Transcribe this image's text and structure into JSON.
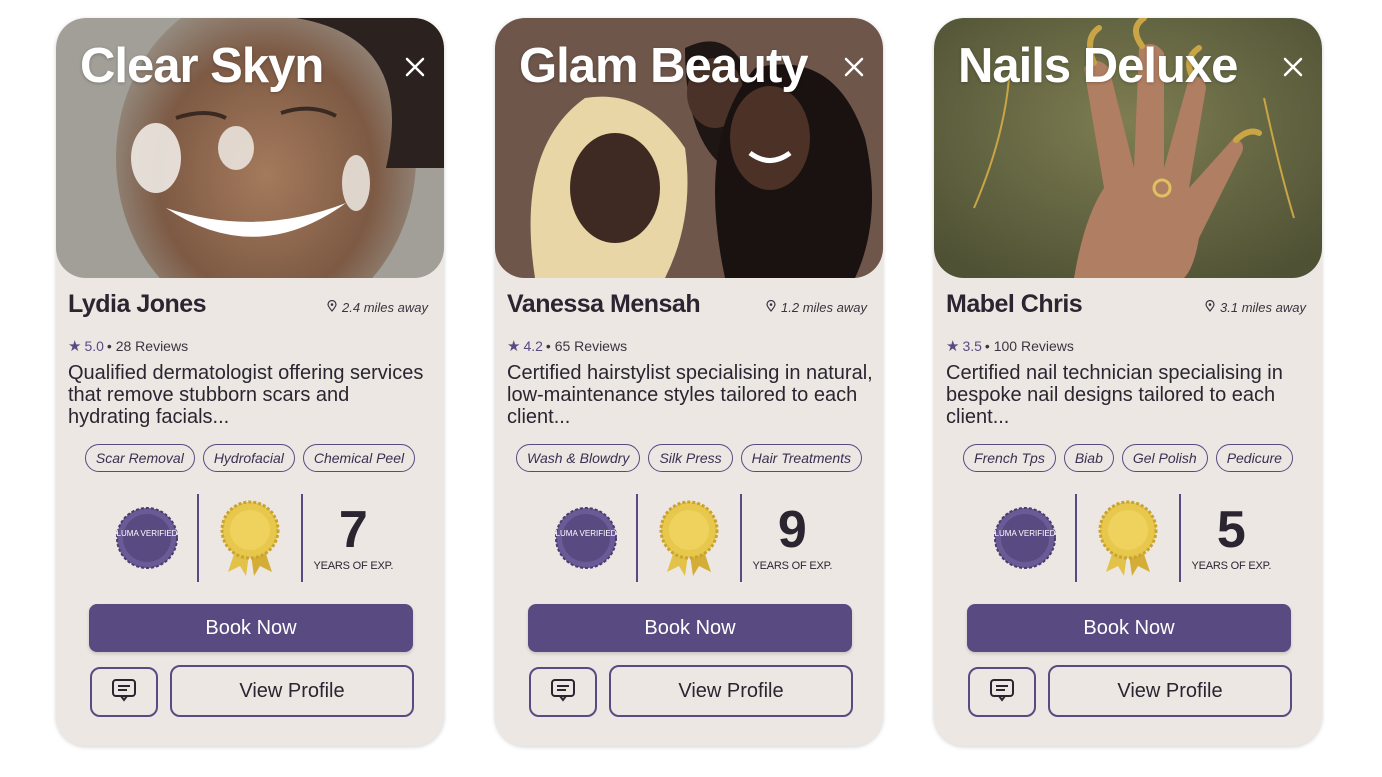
{
  "colors": {
    "accent": "#5a4a82",
    "card_bg": "#ece7e3",
    "text": "#2a2530",
    "gold": "#d9b53a"
  },
  "cards": [
    {
      "brand": "Clear Skyn",
      "name": "Lydia Jones",
      "distance": "2.4 miles away",
      "rating": "5.0",
      "reviews": "• 28 Reviews",
      "description": "Qualified dermatologist offering services that remove stubborn scars and hydrating facials...",
      "tags": [
        "Scar Removal",
        "Hydrofacial",
        "Chemical Peel"
      ],
      "badge_luma": "LUMA VERIFIED",
      "years": "7",
      "years_label": "YEARS OF EXP.",
      "book_label": "Book Now",
      "profile_label": "View Profile"
    },
    {
      "brand": "Glam Beauty",
      "name": "Vanessa Mensah",
      "distance": "1.2 miles away",
      "rating": "4.2",
      "reviews": "• 65 Reviews",
      "description": "Certified hairstylist specialising in natural, low-maintenance styles tailored to each client...",
      "tags": [
        "Wash & Blowdry",
        "Silk Press",
        "Hair Treatments"
      ],
      "badge_luma": "LUMA VERIFIED",
      "years": "9",
      "years_label": "YEARS OF EXP.",
      "book_label": "Book Now",
      "profile_label": "View Profile"
    },
    {
      "brand": "Nails Deluxe",
      "name": "Mabel Chris",
      "distance": "3.1 miles away",
      "rating": "3.5",
      "reviews": "• 100 Reviews",
      "description": "Certified nail technician specialising in bespoke nail designs tailored to each client...",
      "tags": [
        "French Tps",
        "Biab",
        "Gel Polish",
        "Pedicure"
      ],
      "badge_luma": "LUMA VERIFIED",
      "years": "5",
      "years_label": "YEARS OF EXP.",
      "book_label": "Book Now",
      "profile_label": "View Profile"
    }
  ]
}
